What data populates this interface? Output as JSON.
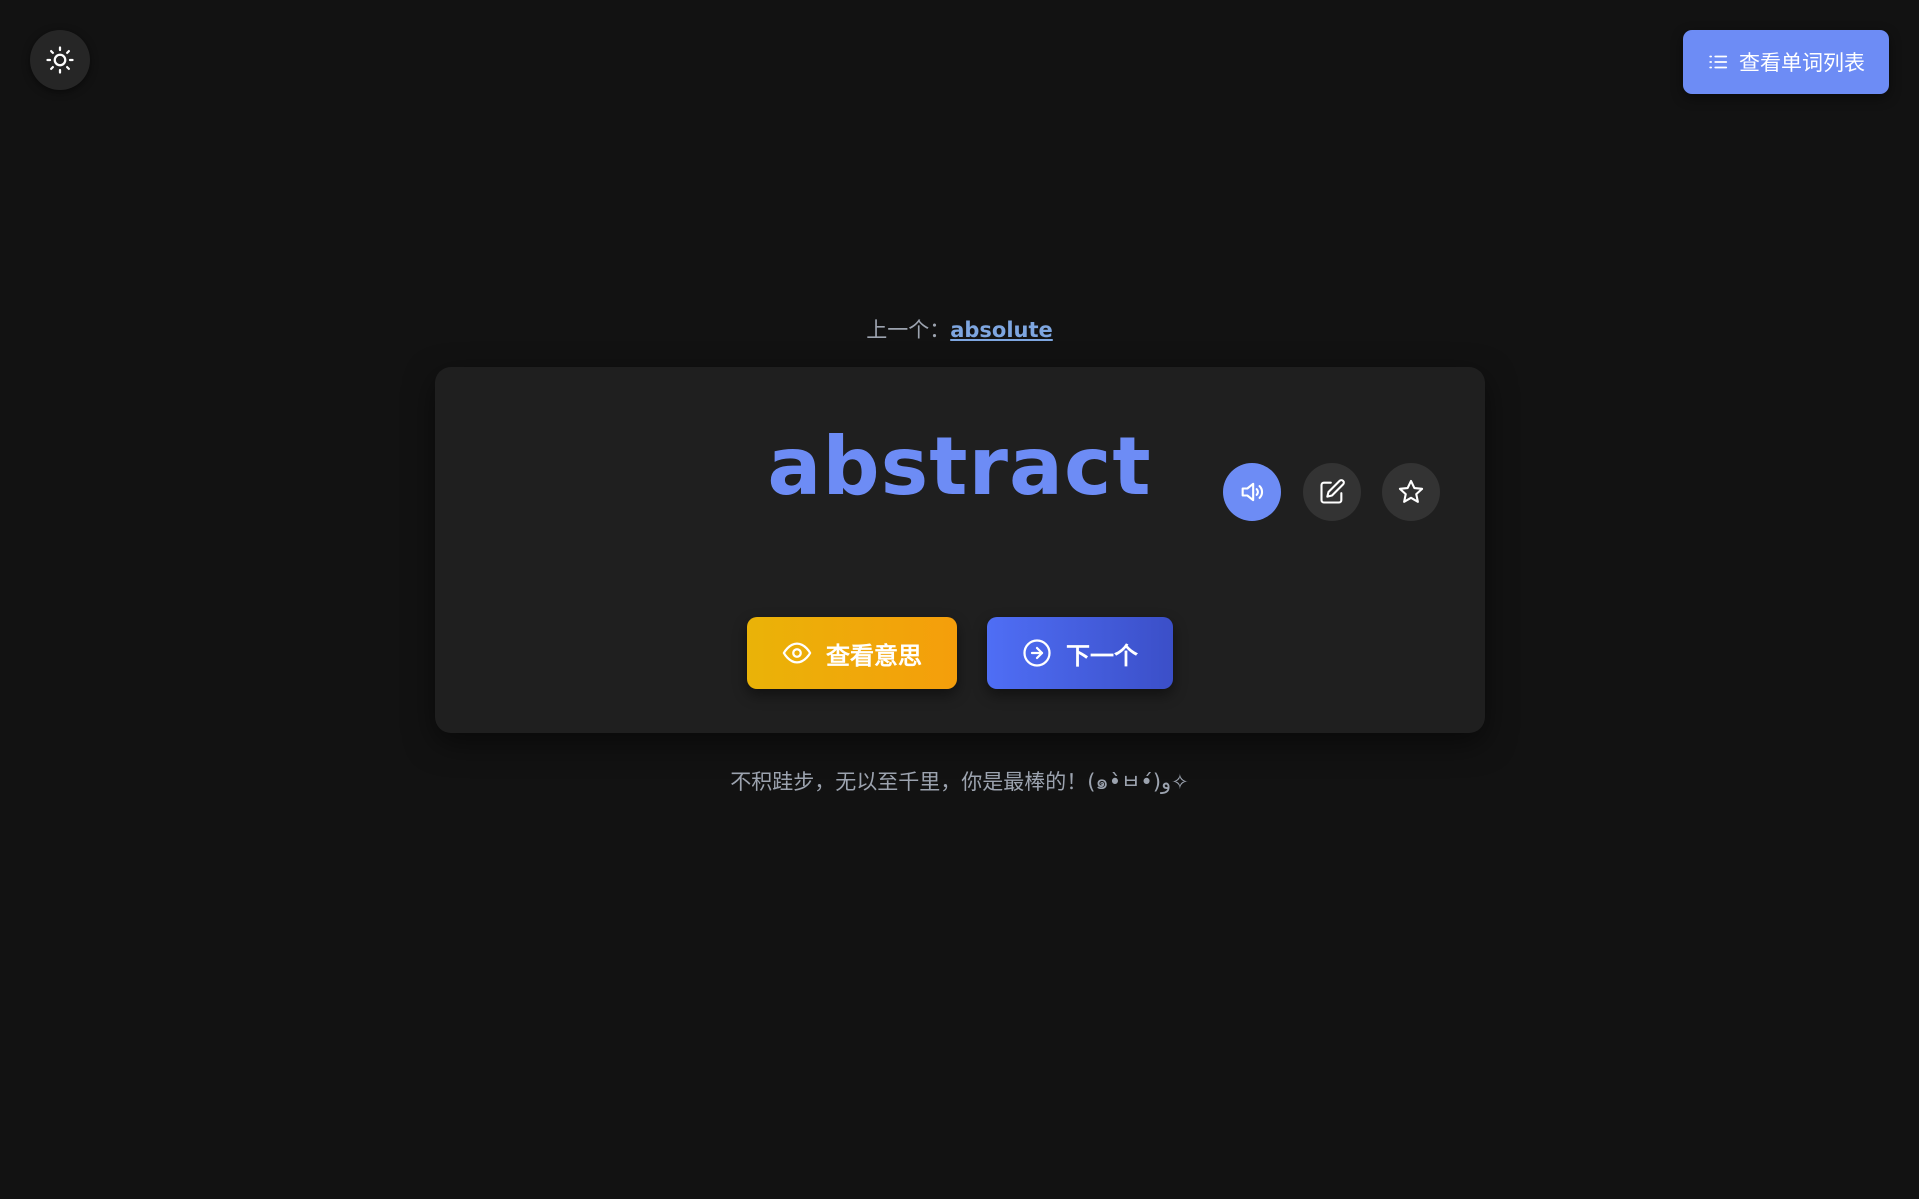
{
  "theme_toggle": {
    "icon": "sun-icon"
  },
  "word_list_button": {
    "icon": "list-icon",
    "label": "查看单词列表"
  },
  "previous": {
    "label": "上一个：",
    "word": "absolute"
  },
  "card": {
    "word": "abstract",
    "speak_icon": "speaker-icon",
    "edit_icon": "edit-icon",
    "star_icon": "star-icon",
    "meaning_button": {
      "icon": "eye-icon",
      "label": "查看意思"
    },
    "next_button": {
      "icon": "arrow-right-circle-icon",
      "label": "下一个"
    }
  },
  "motto": "不积跬步，无以至千里，你是最棒的！(๑•̀ㅂ•́)و✧",
  "colors": {
    "background": "#121212",
    "card": "#1f1f1f",
    "accent": "#6d8cf5",
    "meaning_gradient": [
      "#eab308",
      "#f59e0b"
    ],
    "next_gradient": [
      "#4f6ef5",
      "#3b4fc8"
    ]
  }
}
